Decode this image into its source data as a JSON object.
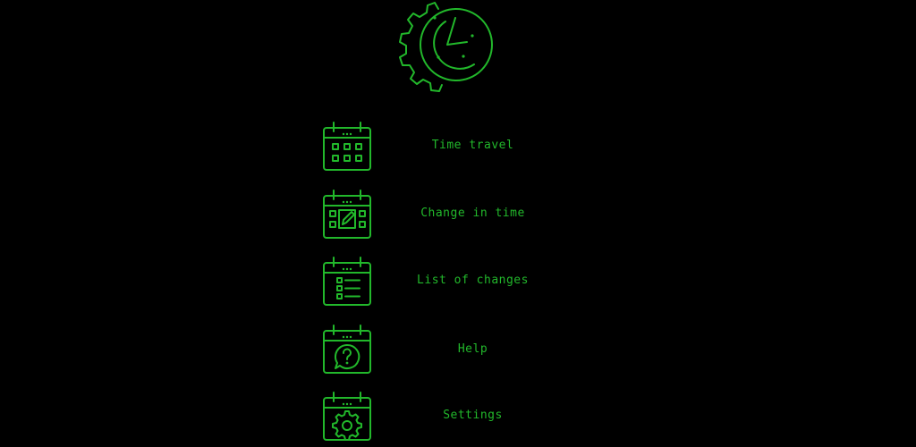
{
  "theme": {
    "background": "#000000",
    "accent": "#22b82b"
  },
  "logo": {
    "icon": "clock-gear-icon"
  },
  "menu": {
    "items": [
      {
        "label": "Time travel",
        "icon": "calendar-grid-icon"
      },
      {
        "label": "Change in time",
        "icon": "calendar-edit-icon"
      },
      {
        "label": "List of changes",
        "icon": "calendar-list-icon"
      },
      {
        "label": "Help",
        "icon": "calendar-help-icon"
      },
      {
        "label": "Settings",
        "icon": "calendar-settings-icon"
      }
    ]
  }
}
